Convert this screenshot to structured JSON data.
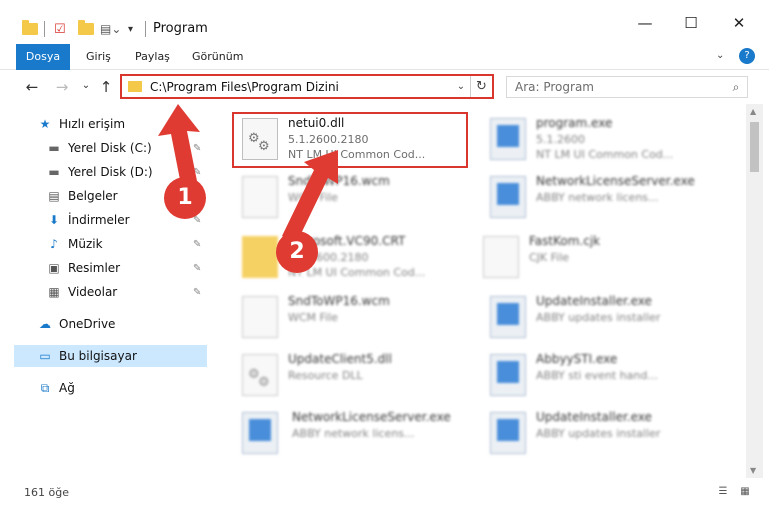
{
  "window": {
    "title": "Program",
    "minimize": "—",
    "maximize": "☐",
    "close": "✕"
  },
  "ribbon": {
    "tabs": [
      "Dosya",
      "Giriş",
      "Paylaş",
      "Görünüm"
    ],
    "collapse": "⌄",
    "help": "?"
  },
  "nav": {
    "back": "←",
    "forward": "→",
    "recent": "⌄",
    "up": "↑",
    "address": "C:\\Program Files\\Program Dizini",
    "address_chevron": "⌄",
    "refresh": "↻",
    "search_placeholder": "Ara: Program",
    "search_icon": "⌕"
  },
  "sidebar": {
    "items": [
      {
        "label": "Hızlı erişim",
        "icon": "★",
        "pinned": false
      },
      {
        "label": "Yerel Disk (C:)",
        "icon": "▬",
        "pinned": true
      },
      {
        "label": "Yerel Disk (D:)",
        "icon": "▬",
        "pinned": true
      },
      {
        "label": "Belgeler",
        "icon": "▤",
        "pinned": true
      },
      {
        "label": "İndirmeler",
        "icon": "⬇",
        "pinned": true
      },
      {
        "label": "Müzik",
        "icon": "♪",
        "pinned": true
      },
      {
        "label": "Resimler",
        "icon": "▣",
        "pinned": true
      },
      {
        "label": "Videolar",
        "icon": "▦",
        "pinned": true
      },
      {
        "label": "OneDrive",
        "icon": "☁",
        "pinned": false
      },
      {
        "label": "Bu bilgisayar",
        "icon": "▭",
        "pinned": false
      },
      {
        "label": "Ağ",
        "icon": "⧉",
        "pinned": false
      }
    ],
    "pin_glyph": "📌"
  },
  "files": [
    {
      "name": "netui0.dll",
      "line2": "5.1.2600.2180",
      "line3": "NT LM UI Common Cod...",
      "type": "dll"
    },
    {
      "name": "program.exe",
      "line2": "5.1.2600",
      "line3": "NT LM UI Common Cod...",
      "type": "exe"
    },
    {
      "name": "SndToWP16.wcm",
      "line2": "WCM File",
      "line3": "",
      "type": "doc"
    },
    {
      "name": "NetworkLicenseServer.exe",
      "line2": "ABBY network licens...",
      "line3": "",
      "type": "app"
    },
    {
      "name": "Microsoft.VC90.CRT",
      "line2": "5.1.2600.2180",
      "line3": "NT LM UI Common Cod...",
      "type": "folder"
    },
    {
      "name": "FastKom.cjk",
      "line2": "CJK File",
      "line3": "",
      "type": "doc"
    },
    {
      "name": "SndToWP16.wcm",
      "line2": "WCM File",
      "line3": "",
      "type": "doc"
    },
    {
      "name": "UpdateInstaller.exe",
      "line2": "ABBY updates installer",
      "line3": "",
      "type": "app"
    },
    {
      "name": "UpdateClient5.dll",
      "line2": "Resource DLL",
      "line3": "",
      "type": "dll"
    },
    {
      "name": "AbbyySTI.exe",
      "line2": "ABBY sti event hand...",
      "line3": "",
      "type": "app"
    },
    {
      "name": "NetworkLicenseServer.exe",
      "line2": "ABBY network licens...",
      "line3": "",
      "type": "app"
    },
    {
      "name": "UpdateInstaller.exe",
      "line2": "ABBY updates installer",
      "line3": "",
      "type": "app"
    }
  ],
  "status": {
    "count": "161 öğe"
  },
  "annotations": {
    "badge1": "1",
    "badge2": "2",
    "color": "#df3b32"
  }
}
